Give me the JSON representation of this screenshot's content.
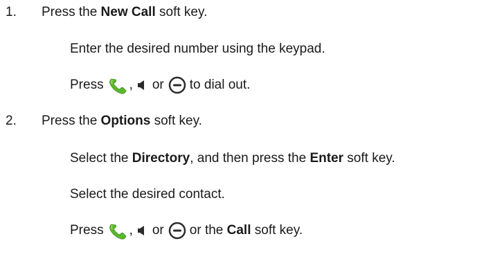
{
  "steps": [
    {
      "number": "1.",
      "line": {
        "prefix": "Press the ",
        "bold": "New Call",
        "suffix": " soft key."
      },
      "sub_lines": {
        "keypad": "Enter the desired number using the keypad.",
        "press_word": "Press",
        "comma": ",",
        "or_word": "or",
        "dial_out": "to dial out."
      }
    },
    {
      "number": "2.",
      "line": {
        "prefix": "Press the ",
        "bold": "Options",
        "suffix": " soft key."
      },
      "sub_lines": {
        "select_prefix": "Select the ",
        "directory": "Directory",
        "select_middle": ", and then press the ",
        "enter": "Enter",
        "select_suffix": " soft key.",
        "contact": "Select the desired contact.",
        "press_word": "Press",
        "comma": ",",
        "or_word": "or",
        "or_the": "or the ",
        "call": "Call",
        "soft_key": " soft key."
      }
    }
  ],
  "icons": {
    "handset": "handset-icon",
    "speaker": "speaker-icon",
    "headset": "headset-icon"
  },
  "colors": {
    "text": "#1a1a1a",
    "handset_green": "#5bb82e",
    "icon_dark": "#2b2b2b"
  }
}
